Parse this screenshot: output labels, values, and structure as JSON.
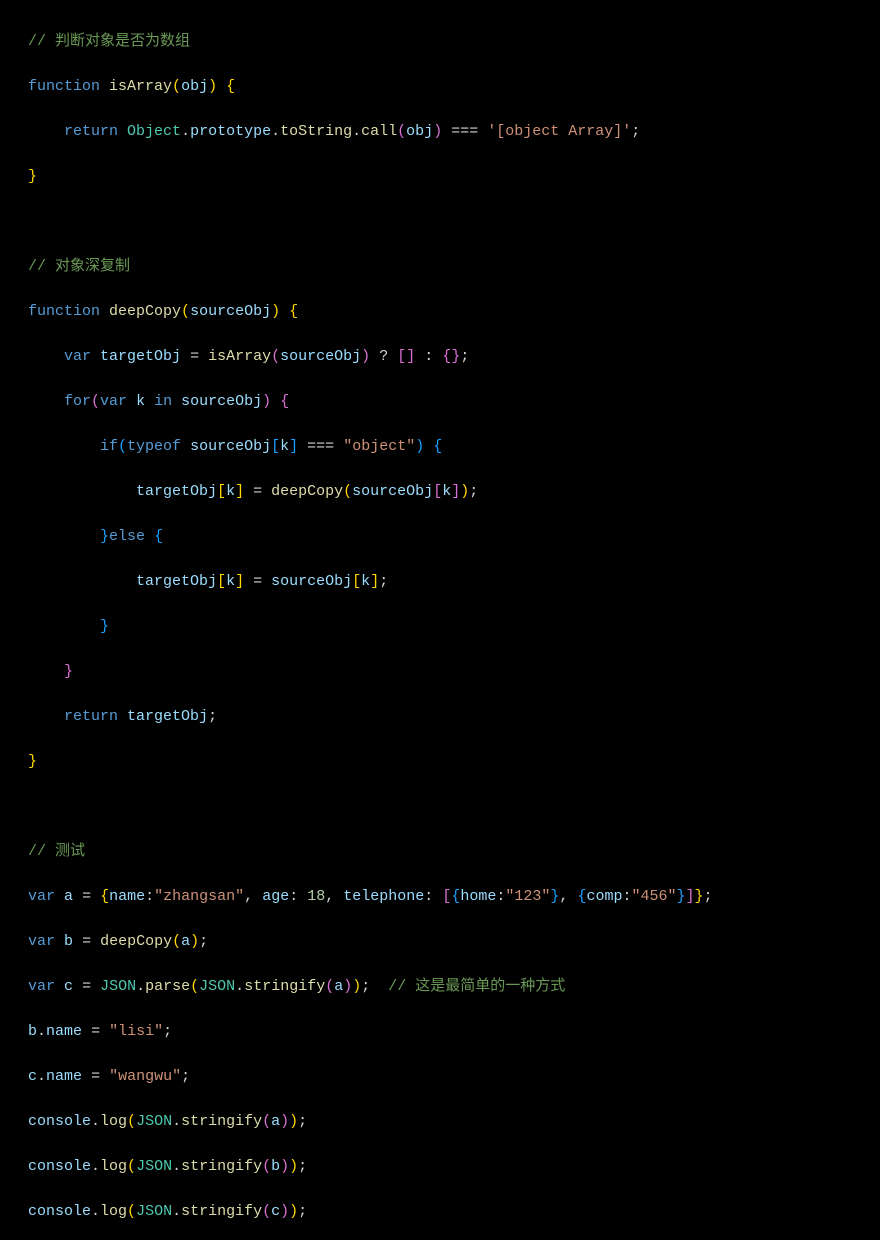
{
  "lines": {
    "c1": "// 判断对象是否为数组",
    "l2_kw1": "function",
    "l2_fn": "isArray",
    "l2_param": "obj",
    "l3_kw": "return",
    "l3_type": "Object",
    "l3_p1": "prototype",
    "l3_p2": "toString",
    "l3_p3": "call",
    "l3_arg": "obj",
    "l3_str": "'[object Array]'",
    "c2": "// 对象深复制",
    "l6_kw": "function",
    "l6_fn": "deepCopy",
    "l6_param": "sourceObj",
    "l7_kw": "var",
    "l7_var": "targetObj",
    "l7_fn": "isArray",
    "l7_arg": "sourceObj",
    "l8_kw1": "for",
    "l8_kw2": "var",
    "l8_var": "k",
    "l8_kw3": "in",
    "l8_obj": "sourceObj",
    "l9_kw1": "if",
    "l9_kw2": "typeof",
    "l9_obj": "sourceObj",
    "l9_k": "k",
    "l9_str": "\"object\"",
    "l10_t": "targetObj",
    "l10_k": "k",
    "l10_fn": "deepCopy",
    "l10_s": "sourceObj",
    "l11_kw": "else",
    "l12_t": "targetObj",
    "l12_k": "k",
    "l12_s": "sourceObj",
    "l15_kw": "return",
    "l15_var": "targetObj",
    "c3": "// 测试",
    "l18_kw": "var",
    "l18_v": "a",
    "l18_p1": "name",
    "l18_s1": "\"zhangsan\"",
    "l18_p2": "age",
    "l18_n": "18",
    "l18_p3": "telephone",
    "l18_p4": "home",
    "l18_s2": "\"123\"",
    "l18_p5": "comp",
    "l18_s3": "\"456\"",
    "l19_kw": "var",
    "l19_v": "b",
    "l19_fn": "deepCopy",
    "l19_arg": "a",
    "l20_kw": "var",
    "l20_v": "c",
    "l20_t": "JSON",
    "l20_f1": "parse",
    "l20_f2": "stringify",
    "l20_arg": "a",
    "c4": "// 这是最简单的一种方式",
    "l21_v": "b",
    "l21_p": "name",
    "l21_s": "\"lisi\"",
    "l22_v": "c",
    "l22_p": "name",
    "l22_s": "\"wangwu\"",
    "l23_o": "console",
    "l23_f": "log",
    "l23_t": "JSON",
    "l23_f2": "stringify",
    "l23_a": "a",
    "l24_o": "console",
    "l24_f": "log",
    "l24_t": "JSON",
    "l24_f2": "stringify",
    "l24_a": "b",
    "l25_o": "console",
    "l25_f": "log",
    "l25_t": "JSON",
    "l25_f2": "stringify",
    "l25_a": "c"
  }
}
